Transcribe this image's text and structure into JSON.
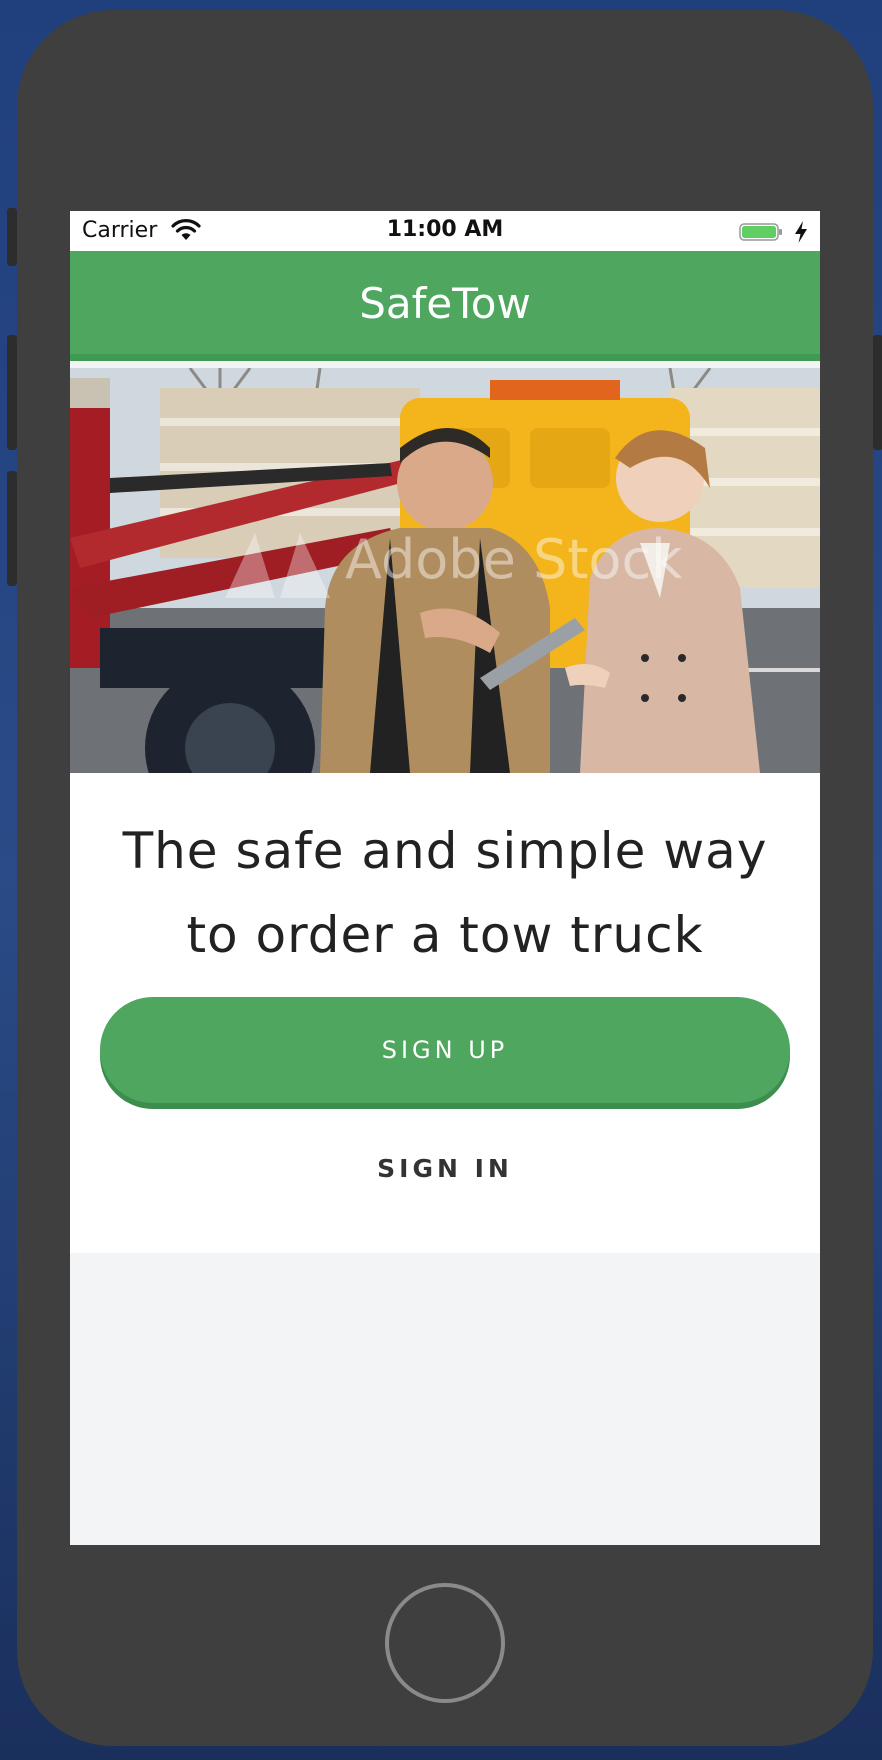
{
  "status_bar": {
    "carrier": "Carrier",
    "time": "11:00 AM"
  },
  "header": {
    "title": "SafeTow"
  },
  "hero": {
    "watermark": "Adobe Stock"
  },
  "main": {
    "headline": "The safe and simple way to order a tow truck",
    "signup_label": "SIGN UP",
    "signin_label": "SIGN IN"
  },
  "colors": {
    "brand_green": "#4ea65f",
    "brand_green_dark": "#3d8d4e",
    "screen_background": "#f3f4f5"
  },
  "icons": [
    "wifi-icon",
    "battery-icon",
    "charging-bolt-icon",
    "home-button"
  ]
}
